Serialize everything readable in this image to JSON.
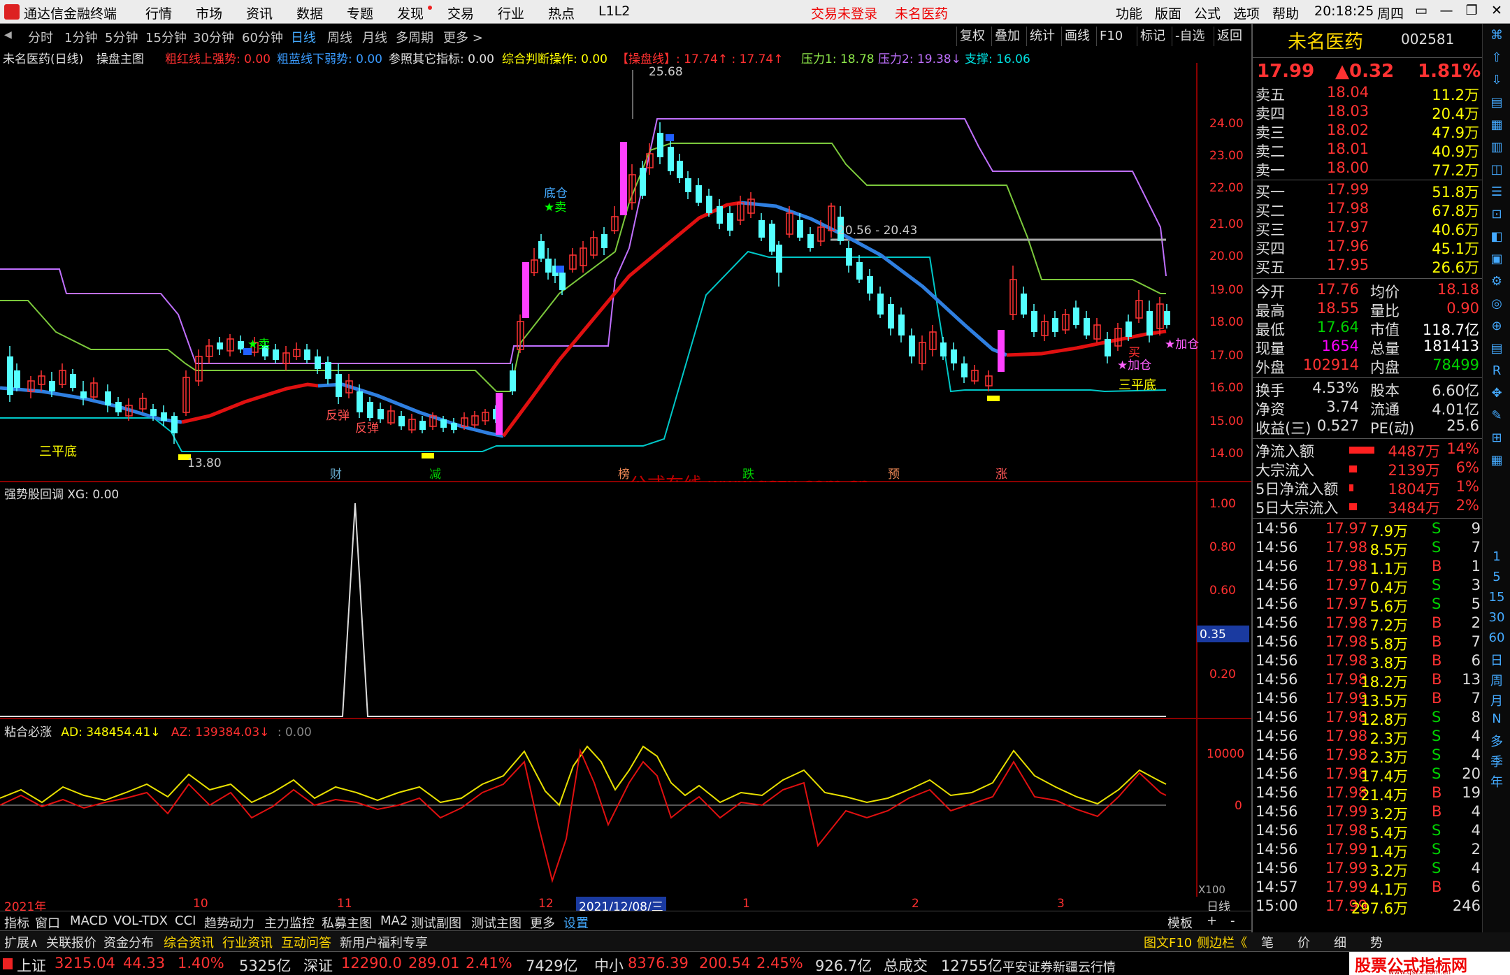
{
  "window": {
    "app_title": "通达信金融终端",
    "menu": [
      "行情",
      "市场",
      "资讯",
      "数据",
      "专题",
      "发现",
      "交易",
      "行业",
      "热点",
      "L1L2"
    ],
    "login_status": "交易未登录",
    "stock_name_title": "未名医药",
    "right_menu": [
      "功能",
      "版面",
      "公式",
      "选项",
      "帮助"
    ],
    "time": "20:18:25",
    "weekday": "周四",
    "window_buttons": [
      "▭",
      "—",
      "❐",
      "✕"
    ]
  },
  "period_tabs": [
    "分时",
    "1分钟",
    "5分钟",
    "15分钟",
    "30分钟",
    "60分钟",
    "日线",
    "周线",
    "月线",
    "多周期",
    "更多 >"
  ],
  "active_period": "日线",
  "chart_tools": [
    "复权",
    "叠加",
    "统计",
    "画线",
    "F10",
    "标记",
    "-自选",
    "返回"
  ],
  "main_legend": {
    "title": "未名医药(日线)",
    "indicator": "操盘主图",
    "items": [
      {
        "text": "粗红线上强势: 0.00",
        "color": "#ff3030"
      },
      {
        "text": "粗蓝线下弱势: 0.00",
        "color": "#3a9bff"
      },
      {
        "text": "参照其它指标: 0.00",
        "color": "#e0e0e0"
      },
      {
        "text": "综合判断操作: 0.00",
        "color": "#ffff00"
      },
      {
        "text": "【操盘线】: 17.74↑ : 17.74↑",
        "color": "#ff3030"
      },
      {
        "text": "压力1: 18.78",
        "color": "#8ee84a"
      },
      {
        "text": "压力2: 19.38↓",
        "color": "#c070ff"
      },
      {
        "text": "支撑: 16.06",
        "color": "#00e0e0"
      }
    ]
  },
  "price_axis": [
    "24.00",
    "23.00",
    "22.00",
    "21.00",
    "20.00",
    "19.00",
    "18.00",
    "17.00",
    "16.00",
    "15.00",
    "14.00"
  ],
  "annotations": {
    "high": "25.68",
    "low": "13.80",
    "range_line": "20.56 - 20.43",
    "labels": [
      "三平底",
      "三平底",
      "★卖",
      "★卖",
      "底仓",
      "反弹",
      "反弹",
      "★加仓",
      "★加仓",
      "买"
    ],
    "event_markers": [
      "财",
      "减",
      "榜",
      "跌",
      "预",
      "涨"
    ]
  },
  "watermark": "公式在线  www.gszx.com.cn",
  "sub1": {
    "legend": "强势股回调  XG: 0.00",
    "axis": [
      "1.00",
      "0.80",
      "0.60",
      "0.35",
      "0.20"
    ],
    "cursor_value": "0.35"
  },
  "sub2": {
    "legend_title": "粘合必涨",
    "ad": "AD: 348454.41↓",
    "az": "AZ: 139384.03↓",
    "extra": ": 0.00",
    "axis": [
      "10000",
      "0"
    ],
    "scale": "X100"
  },
  "time_axis": [
    "2021年",
    "10",
    "11",
    "12",
    "2021/12/08/三",
    "1",
    "2",
    "3"
  ],
  "time_axis_period": "日线",
  "bottom_tabs": [
    "指标",
    "窗口",
    "MACD",
    "VOL-TDX",
    "CCI",
    "趋势动力",
    "主力监控",
    "私募主图",
    "MA2",
    "测试副图",
    "测试主图",
    "更多",
    "设置"
  ],
  "bottom_tabs_right": [
    "模板",
    "+",
    "-"
  ],
  "bottom2_tabs": [
    "扩展∧",
    "关联报价",
    "资金分布",
    "综合资讯",
    "行业资讯",
    "互动问答",
    "新用户福利专享"
  ],
  "bottom2_right": [
    "图文F10",
    "侧边栏《",
    "笔",
    "价",
    "细",
    "势"
  ],
  "quote": {
    "name": "未名医药",
    "code": "002581",
    "price": "17.99",
    "change": "▲0.32",
    "pct": "1.81%",
    "asks": [
      {
        "label": "卖五",
        "price": "18.04",
        "vol": "11.2万"
      },
      {
        "label": "卖四",
        "price": "18.03",
        "vol": "20.4万"
      },
      {
        "label": "卖三",
        "price": "18.02",
        "vol": "47.9万"
      },
      {
        "label": "卖二",
        "price": "18.01",
        "vol": "40.9万"
      },
      {
        "label": "卖一",
        "price": "18.00",
        "vol": "77.2万"
      }
    ],
    "bids": [
      {
        "label": "买一",
        "price": "17.99",
        "vol": "51.8万"
      },
      {
        "label": "买二",
        "price": "17.98",
        "vol": "67.8万"
      },
      {
        "label": "买三",
        "price": "17.97",
        "vol": "40.6万"
      },
      {
        "label": "买四",
        "price": "17.96",
        "vol": "45.1万"
      },
      {
        "label": "买五",
        "price": "17.95",
        "vol": "26.6万"
      }
    ],
    "stats": [
      {
        "l1": "今开",
        "v1": "17.76",
        "c1": "red",
        "l2": "均价",
        "v2": "18.18",
        "c2": "red"
      },
      {
        "l1": "最高",
        "v1": "18.55",
        "c1": "red",
        "l2": "量比",
        "v2": "0.90",
        "c2": "red"
      },
      {
        "l1": "最低",
        "v1": "17.64",
        "c1": "grn",
        "l2": "市值",
        "v2": "118.7亿",
        "c2": "wht"
      },
      {
        "l1": "现量",
        "v1": "1654",
        "c1": "mag",
        "l2": "总量",
        "v2": "181413",
        "c2": "wht"
      },
      {
        "l1": "外盘",
        "v1": "102914",
        "c1": "red",
        "l2": "内盘",
        "v2": "78499",
        "c2": "grn"
      }
    ],
    "stats2": [
      {
        "l1": "换手",
        "v1": "4.53%",
        "l2": "股本",
        "v2": "6.60亿"
      },
      {
        "l1": "净资",
        "v1": "3.74",
        "l2": "流通",
        "v2": "4.01亿"
      },
      {
        "l1": "收益(三)",
        "v1": "0.527",
        "l2": "PE(动)",
        "v2": "25.6"
      }
    ],
    "flows": [
      {
        "label": "净流入额",
        "bar": 60,
        "value": "4487万",
        "pct": "14%"
      },
      {
        "label": "大宗流入",
        "bar": 18,
        "value": "2139万",
        "pct": "6%"
      },
      {
        "label": "5日净流入额",
        "bar": 10,
        "value": "1804万",
        "pct": "1%"
      },
      {
        "label": "5日大宗流入",
        "bar": 18,
        "value": "3484万",
        "pct": "2%"
      }
    ],
    "ticks": [
      {
        "t": "14:56",
        "p": "17.97",
        "v": "7.9万",
        "s": "S",
        "n": "9"
      },
      {
        "t": "14:56",
        "p": "17.98",
        "v": "8.5万",
        "s": "S",
        "n": "7"
      },
      {
        "t": "14:56",
        "p": "17.98",
        "v": "1.1万",
        "s": "B",
        "n": "1"
      },
      {
        "t": "14:56",
        "p": "17.97",
        "v": "0.4万",
        "s": "S",
        "n": "3"
      },
      {
        "t": "14:56",
        "p": "17.97",
        "v": "5.6万",
        "s": "S",
        "n": "5"
      },
      {
        "t": "14:56",
        "p": "17.98",
        "v": "7.2万",
        "s": "B",
        "n": "2"
      },
      {
        "t": "14:56",
        "p": "17.98",
        "v": "5.8万",
        "s": "B",
        "n": "7"
      },
      {
        "t": "14:56",
        "p": "17.98",
        "v": "3.8万",
        "s": "B",
        "n": "6"
      },
      {
        "t": "14:56",
        "p": "17.98",
        "v": "18.2万",
        "s": "B",
        "n": "13"
      },
      {
        "t": "14:56",
        "p": "17.99",
        "v": "13.5万",
        "s": "B",
        "n": "7"
      },
      {
        "t": "14:56",
        "p": "17.98",
        "v": "12.8万",
        "s": "S",
        "n": "8"
      },
      {
        "t": "14:56",
        "p": "17.98",
        "v": "2.3万",
        "s": "S",
        "n": "4"
      },
      {
        "t": "14:56",
        "p": "17.98",
        "v": "2.3万",
        "s": "S",
        "n": "4"
      },
      {
        "t": "14:56",
        "p": "17.98",
        "v": "17.4万",
        "s": "S",
        "n": "20"
      },
      {
        "t": "14:56",
        "p": "17.98",
        "v": "21.4万",
        "s": "B",
        "n": "19"
      },
      {
        "t": "14:56",
        "p": "17.99",
        "v": "3.2万",
        "s": "B",
        "n": "4"
      },
      {
        "t": "14:56",
        "p": "17.98",
        "v": "5.4万",
        "s": "S",
        "n": "4"
      },
      {
        "t": "14:56",
        "p": "17.99",
        "v": "1.4万",
        "s": "S",
        "n": "2"
      },
      {
        "t": "14:56",
        "p": "17.99",
        "v": "3.2万",
        "s": "S",
        "n": "4"
      },
      {
        "t": "14:57",
        "p": "17.99",
        "v": "4.1万",
        "s": "B",
        "n": "6"
      },
      {
        "t": "15:00",
        "p": "17.99",
        "v": "297.6万",
        "s": "",
        "n": "246"
      }
    ]
  },
  "sidebar_periods": [
    "1",
    "5",
    "15",
    "30",
    "60",
    "日",
    "周",
    "月",
    "N",
    "多",
    "季",
    "年"
  ],
  "status": {
    "sh_label": "上证",
    "sh": "3215.04",
    "sh_chg": "44.33",
    "sh_pct": "1.40%",
    "sh_amt": "5325亿",
    "sz_label": "深证",
    "sz": "12290.0",
    "sz_chg": "289.01",
    "sz_pct": "2.41%",
    "sz_amt": "7429亿",
    "zx_label": "中小",
    "zx": "8376.39",
    "zx_chg": "200.54",
    "zx_pct": "2.45%",
    "zx_amt": "926.7亿",
    "total_label": "总成交",
    "total": "12755亿",
    "broker": "平安证券新疆云行情",
    "logo": "股票公式指标网",
    "logo_url": "www.gszx.com.cn"
  }
}
